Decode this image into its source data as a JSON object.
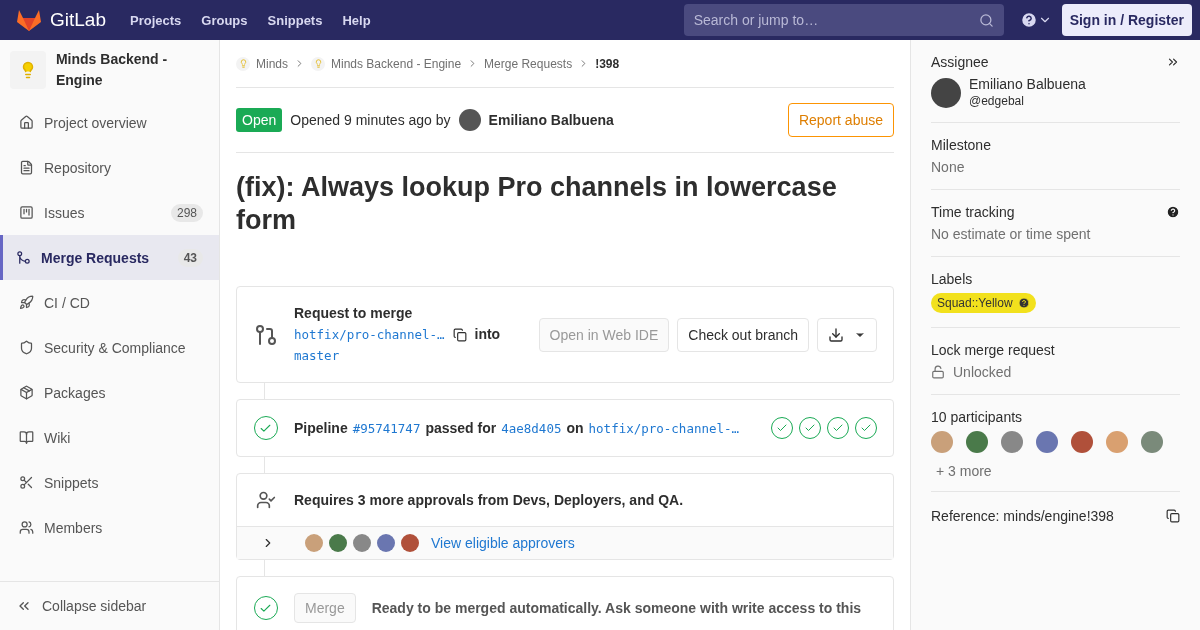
{
  "navbar": {
    "logo_text": "GitLab",
    "links": [
      "Projects",
      "Groups",
      "Snippets",
      "Help"
    ],
    "search": {
      "placeholder": "Search or jump to…"
    },
    "sign_in": "Sign in / Register"
  },
  "sidebar": {
    "project_name": "Minds Backend - Engine",
    "items": [
      {
        "label": "Project overview",
        "selected": false
      },
      {
        "label": "Repository",
        "selected": false
      },
      {
        "label": "Issues",
        "count": "298",
        "selected": false
      },
      {
        "label": "Merge Requests",
        "count": "43",
        "selected": true
      },
      {
        "label": "CI / CD",
        "selected": false
      },
      {
        "label": "Security & Compliance",
        "selected": false
      },
      {
        "label": "Packages",
        "selected": false
      },
      {
        "label": "Wiki",
        "selected": false
      },
      {
        "label": "Snippets",
        "selected": false
      },
      {
        "label": "Members",
        "selected": false
      }
    ],
    "collapse": "Collapse sidebar"
  },
  "breadcrumbs": [
    {
      "label": "Minds",
      "kind": "group"
    },
    {
      "label": "Minds Backend - Engine",
      "kind": "group"
    },
    {
      "label": "Merge Requests",
      "kind": "link"
    },
    {
      "label": "!398",
      "kind": "current"
    }
  ],
  "header": {
    "status": "Open",
    "opened": "Opened 9 minutes ago by",
    "author": "Emiliano Balbuena",
    "report": "Report abuse"
  },
  "title": "(fix): Always lookup Pro channels in lowercase form",
  "request": {
    "heading": "Request to merge",
    "source": "hotfix/pro-channel-…",
    "into": "into",
    "target": "master",
    "buttons": [
      {
        "label": "Open in Web IDE",
        "disabled": true
      },
      {
        "label": "Check out branch",
        "disabled": false
      }
    ]
  },
  "pipeline": {
    "label": "Pipeline",
    "id": "#95741747",
    "passed_for": "passed for",
    "commit": "4ae8d405",
    "on": "on",
    "branch": "hotfix/pro-channel-…",
    "stages": [
      {
        "passed": true
      },
      {
        "passed": true
      },
      {
        "passed": true
      },
      {
        "passed": true
      }
    ]
  },
  "approvals": {
    "text": "Requires 3 more approvals from Devs, Deployers, and QA.",
    "expanded": false,
    "link": "View eligible approvers"
  },
  "merge": {
    "button": "Merge",
    "disabled": true,
    "text": "Ready to be merged automatically. Ask someone with write access to this"
  },
  "right_sidebar": {
    "assignee": {
      "heading": "Assignee",
      "name": "Emiliano Balbuena",
      "username": "@edgebal"
    },
    "milestone": {
      "heading": "Milestone",
      "value": "None"
    },
    "time_tracking": {
      "heading": "Time tracking",
      "value": "No estimate or time spent"
    },
    "labels": {
      "heading": "Labels",
      "items": [
        {
          "label": "Squad::Yellow",
          "color": "#f2e11d"
        }
      ]
    },
    "lock": {
      "heading": "Lock merge request",
      "value": "Unlocked",
      "locked": false
    },
    "participants": {
      "heading": "10 participants",
      "more": "+ 3 more"
    },
    "reference": "Reference: minds/engine!398"
  }
}
